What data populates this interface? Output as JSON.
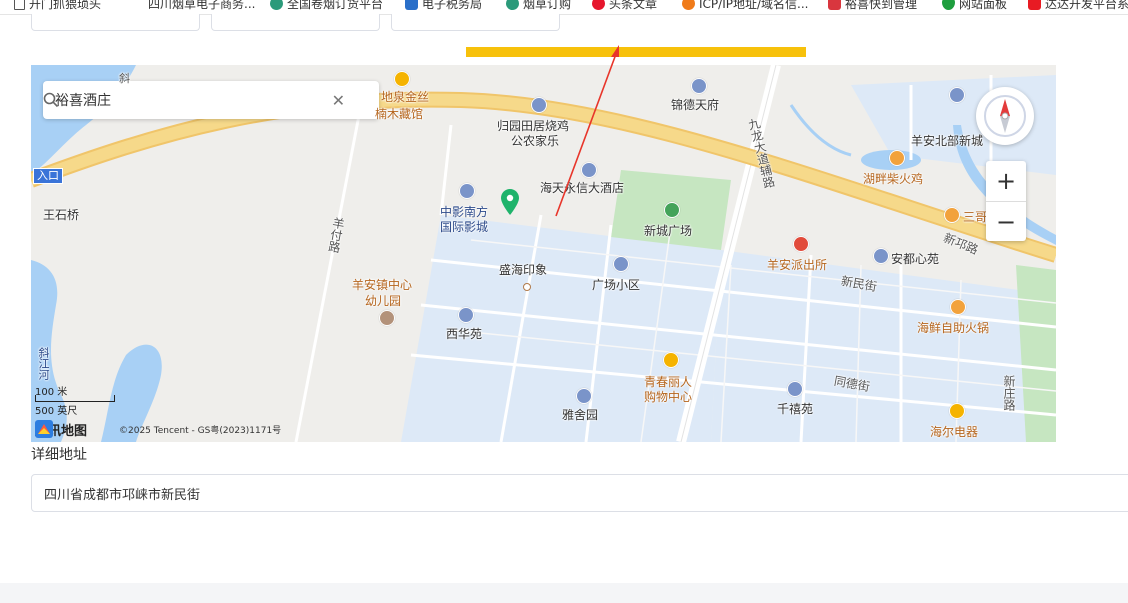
{
  "bookmarks": [
    {
      "label": "开门抓猥琐头",
      "icon": "page-icon"
    },
    {
      "label": "四川烟草电子商务...",
      "icon": "none"
    },
    {
      "label": "全国卷烟订货平台",
      "icon": "tobacco-icon"
    },
    {
      "label": "电子税务局",
      "icon": "tax-icon"
    },
    {
      "label": "烟草订购",
      "icon": "tobacco-icon"
    },
    {
      "label": "头条文章",
      "icon": "weibo-icon"
    },
    {
      "label": "ICP/IP地址/域名信...",
      "icon": "icp-icon"
    },
    {
      "label": "裕喜快到管理",
      "icon": "grid-icon"
    },
    {
      "label": "网站面板",
      "icon": "shield-icon"
    },
    {
      "label": "达达开发平台系",
      "icon": "dada-icon"
    }
  ],
  "map": {
    "search": {
      "value": "裕喜酒庄"
    },
    "entry_badge": "入口",
    "labels": [
      {
        "text": "地泉金丝",
        "cls": "brown"
      },
      {
        "text": "楠木藏馆",
        "cls": "brown"
      },
      {
        "text": "归园田居烧鸡",
        "cls": ""
      },
      {
        "text": "公农家乐",
        "cls": ""
      },
      {
        "text": "锦德天府",
        "cls": ""
      },
      {
        "text": "羊安北部新城",
        "cls": ""
      },
      {
        "text": "湖畔柴火鸡",
        "cls": "brown"
      },
      {
        "text": "海天永信大酒店",
        "cls": ""
      },
      {
        "text": "中影南方",
        "cls": "blue"
      },
      {
        "text": "国际影城",
        "cls": "blue"
      },
      {
        "text": "新城广场",
        "cls": ""
      },
      {
        "text": "王石桥",
        "cls": ""
      },
      {
        "text": "盛海印象",
        "cls": ""
      },
      {
        "text": "广场小区",
        "cls": ""
      },
      {
        "text": "羊安派出所",
        "cls": "brown"
      },
      {
        "text": "安都心苑",
        "cls": ""
      },
      {
        "text": "三哥",
        "cls": "brown"
      },
      {
        "text": "羊安镇中心",
        "cls": "brown"
      },
      {
        "text": "幼儿园",
        "cls": "brown"
      },
      {
        "text": "新民街",
        "cls": "road"
      },
      {
        "text": "海鲜自助火锅",
        "cls": "brown"
      },
      {
        "text": "西华苑",
        "cls": ""
      },
      {
        "text": "青春丽人",
        "cls": "brown"
      },
      {
        "text": "购物中心",
        "cls": "brown"
      },
      {
        "text": "同德街",
        "cls": "road"
      },
      {
        "text": "千禧苑",
        "cls": ""
      },
      {
        "text": "雅舍园",
        "cls": ""
      },
      {
        "text": "海尔电器",
        "cls": "brown"
      },
      {
        "text": "新庄路",
        "cls": "road"
      },
      {
        "text": "九龙大道辅路",
        "cls": "road"
      },
      {
        "text": "新邛路",
        "cls": "road"
      },
      {
        "text": "羊付路",
        "cls": "road"
      },
      {
        "text": "斜江河",
        "cls": "blue"
      },
      {
        "text": "斜",
        "cls": "road"
      }
    ],
    "scale": {
      "metric": "100 米",
      "imperial": "500 英尺"
    },
    "logo_text": "腾讯地图",
    "copyright": "©2025 Tencent - GS粤(2023)1171号",
    "zoom_in": "+",
    "zoom_out": "−"
  },
  "form": {
    "address_label": "详细地址",
    "address_value": "四川省成都市邛崃市新民街"
  },
  "colors": {
    "annotation_bar": "#f7c10b",
    "annotation_arrow": "#e8352a",
    "marker": "#1fb36b",
    "water": "#a8d0f5",
    "residential": "#dde9f7",
    "park": "#c6e6c1",
    "highway": "#f6d98a"
  }
}
